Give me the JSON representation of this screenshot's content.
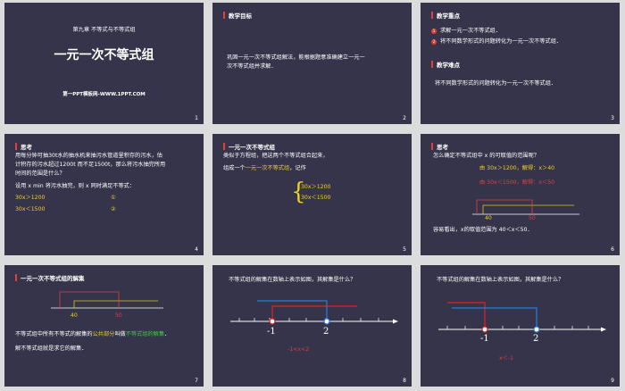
{
  "s1": {
    "chapter": "第九章 不等式与不等式组",
    "title": "一元一次不等式组",
    "site": "第一PPT模板网-WWW.1PPT.COM",
    "num": "1"
  },
  "s2": {
    "header": "教学目标",
    "body1": "巩固一元一次不等式组解法，能根据题意准确建立一元一",
    "body2": "次不等式组并求解．",
    "num": "2"
  },
  "s3": {
    "header1": "教学重点",
    "item1": "求解一元一次不等式组．",
    "item2": "将不同数学形式的问题转化为一元一次不等式组．",
    "header2": "教学难点",
    "body": "将不同数学形式的问题转化为一元一次不等式组．",
    "num": "3"
  },
  "s4": {
    "header": "思考",
    "l1": "用每分钟可抽30t水的抽水机来抽污水管道里积存的污水，估",
    "l2": "计积存的污水超过1200t 而不足1500t，那么将污水抽完所用",
    "l3": "时间的范围是什么？",
    "l4": "设用 x min 将污水抽完，则 x 同时满足不等式：",
    "ineq1": "30x＞1200",
    "mark1": "①",
    "ineq2": "30x＜1500",
    "mark2": "②",
    "num": "4"
  },
  "s5": {
    "header": "一元一次不等式组",
    "l1": "类似于方程组，把这两个不等式组合起来，",
    "l2a": "组成一个",
    "l2b": "一元一次不等式组",
    "l2c": "，记作",
    "ineq1": "30x＞1200",
    "ineq2": "30x＜1500",
    "num": "5"
  },
  "s6": {
    "header": "思考",
    "q": "怎么确定不等式组中 x 的可取值的范围呢？",
    "a1": "由 30x＞1200，解得：x＞40",
    "a2": "由 30x＜1500，解得：x＜50",
    "tick1": "40",
    "tick2": "50",
    "conclusion": "容易看出，x的取值范围为 40＜x＜50．",
    "num": "6"
  },
  "s7": {
    "header": "一元一次不等式组的解集",
    "tick1": "40",
    "tick2": "50",
    "l1a": "不等式组中所有不等式的解集的",
    "l1b": "公共部分",
    "l1c": "叫做",
    "l1d": "不等式组的解集",
    "l1e": "．",
    "l2": "解不等式组就是求它的解集．",
    "num": "7"
  },
  "s8": {
    "q": "不等式组的解集在数轴上表示如图，其解集是什么？",
    "tick1": "-1",
    "tick2": "2",
    "answer": "-1<x<2",
    "num": "8"
  },
  "s9": {
    "q": "不等式组的解集在数轴上表示如图，其解集是什么？",
    "tick1": "-1",
    "tick2": "2",
    "answer": "x＜-1",
    "num": "9"
  }
}
